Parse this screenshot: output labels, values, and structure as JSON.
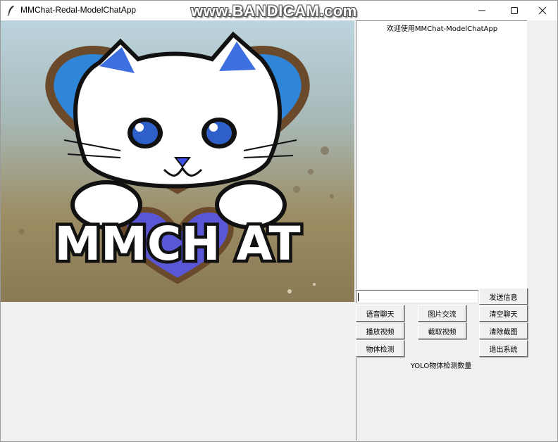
{
  "window": {
    "title": "MMChat-Redal-ModelChatApp"
  },
  "watermark": "www.BANDICAM.com",
  "logo": {
    "text": "MMCH AT"
  },
  "chat": {
    "welcome": "欢迎使用MMChat-ModelChatApp",
    "input_value": ""
  },
  "buttons": {
    "send": "发送信息",
    "voice_chat": "语音聊天",
    "image_chat": "图片交流",
    "clear_chat": "清空聊天",
    "play_video": "播放视频",
    "capture_video": "截取视频",
    "clear_screenshot": "清除截图",
    "object_detect": "物体检测",
    "exit_system": "退出系统"
  },
  "yolo": {
    "count_label": "YOLO物体检测数量"
  },
  "colors": {
    "accent_blue": "#2f86d8",
    "heart_purple": "#5a57d6",
    "frame_brown": "#7a5a3c"
  }
}
